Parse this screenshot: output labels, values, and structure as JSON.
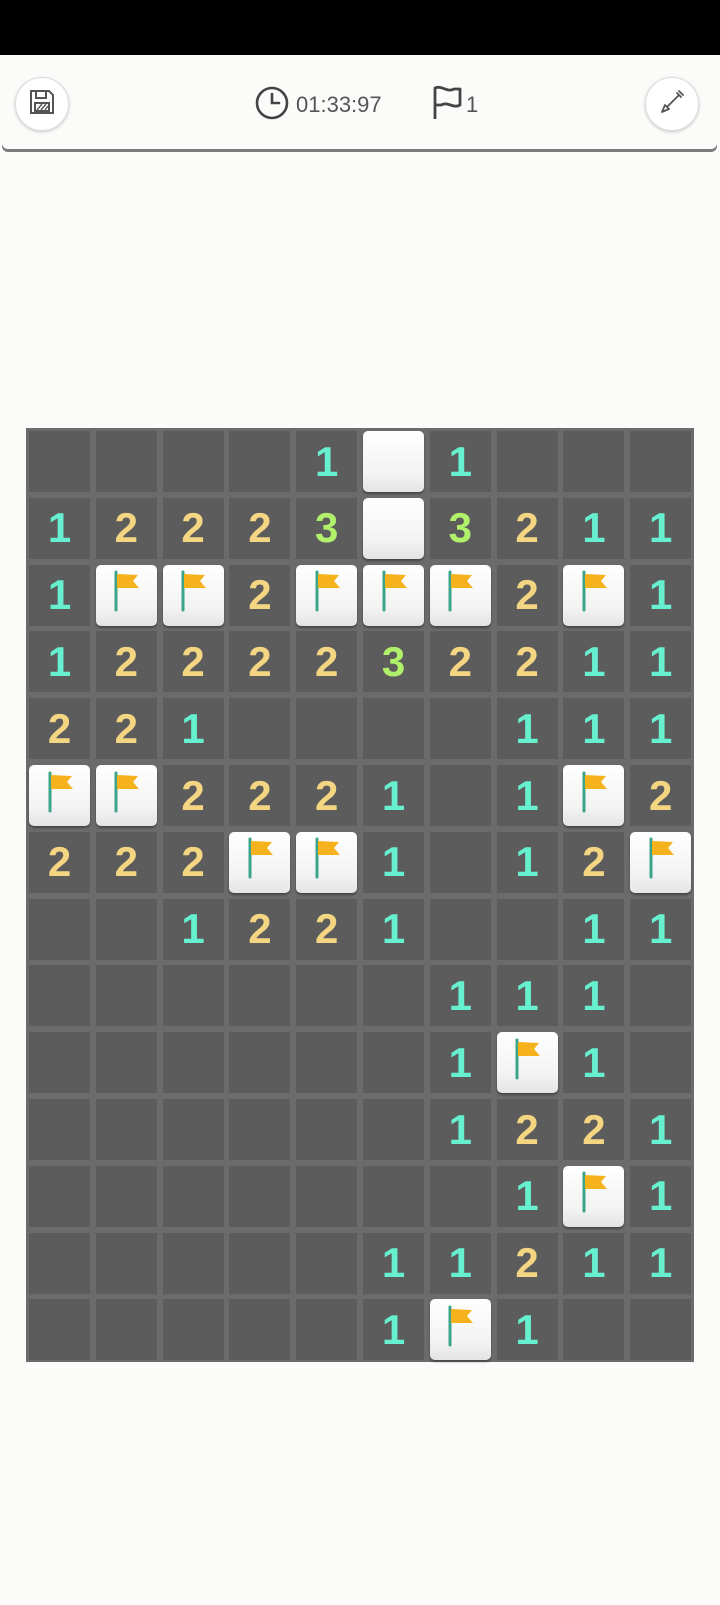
{
  "header": {
    "timer": "01:33:97",
    "flag_count": "1"
  },
  "colors": {
    "n1": "#67f0d0",
    "n2": "#f4d682",
    "n3": "#b0f06a",
    "hidden_cell": "#5c5c5c",
    "flag": "#f6b21c",
    "flag_pole": "#3aa58a"
  },
  "board": {
    "legend": "H = unrevealed, . = revealed empty, F = flag, digit = adjacent mine count",
    "rows": [
      [
        "H",
        "H",
        "H",
        "H",
        "1",
        ".",
        "1",
        "H",
        "H",
        "H"
      ],
      [
        "1",
        "2",
        "2",
        "2",
        "3",
        ".",
        "3",
        "2",
        "1",
        "1"
      ],
      [
        "1",
        "F",
        "F",
        "2",
        "F",
        "F",
        "F",
        "2",
        "F",
        "1"
      ],
      [
        "1",
        "2",
        "2",
        "2",
        "2",
        "3",
        "2",
        "2",
        "1",
        "1"
      ],
      [
        "2",
        "2",
        "1",
        "H",
        "H",
        "H",
        "H",
        "1",
        "1",
        "1"
      ],
      [
        "F",
        "F",
        "2",
        "2",
        "2",
        "1",
        "H",
        "1",
        "F",
        "2"
      ],
      [
        "2",
        "2",
        "2",
        "F",
        "F",
        "1",
        "H",
        "1",
        "2",
        "F"
      ],
      [
        "H",
        "H",
        "1",
        "2",
        "2",
        "1",
        "H",
        "H",
        "1",
        "1"
      ],
      [
        "H",
        "H",
        "H",
        "H",
        "H",
        "H",
        "1",
        "1",
        "1",
        "H"
      ],
      [
        "H",
        "H",
        "H",
        "H",
        "H",
        "H",
        "1",
        "F",
        "1",
        "H"
      ],
      [
        "H",
        "H",
        "H",
        "H",
        "H",
        "H",
        "1",
        "2",
        "2",
        "1"
      ],
      [
        "H",
        "H",
        "H",
        "H",
        "H",
        "H",
        "H",
        "1",
        "F",
        "1"
      ],
      [
        "H",
        "H",
        "H",
        "H",
        "H",
        "1",
        "1",
        "2",
        "1",
        "1"
      ],
      [
        "H",
        "H",
        "H",
        "H",
        "H",
        "1",
        "F",
        "1",
        "H",
        "H"
      ]
    ]
  }
}
